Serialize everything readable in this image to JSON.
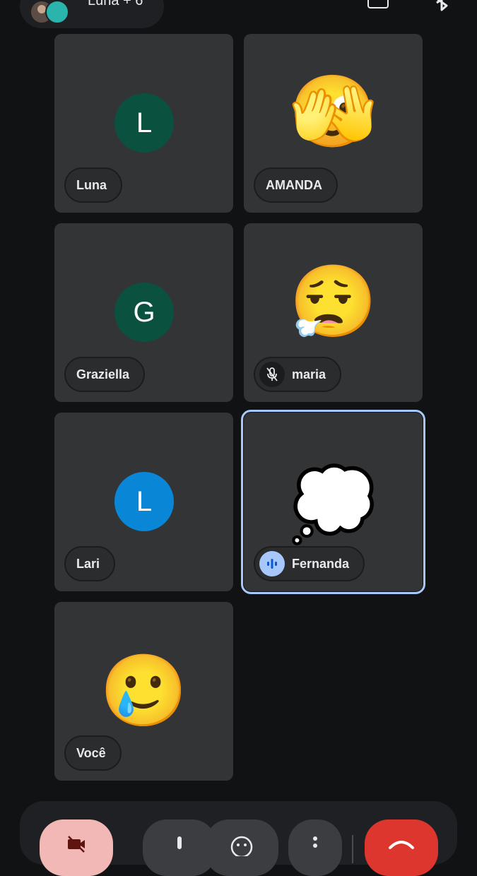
{
  "header": {
    "call_title": "Luna + 6",
    "icons": [
      "participant-avatars",
      "switch-camera-icon",
      "bluetooth-icon"
    ]
  },
  "participants": [
    {
      "name": "Luna",
      "initial": "L",
      "avatar_color": "#0b5140"
    },
    {
      "name": "AMANDA",
      "emoji": "🫣"
    },
    {
      "name": "Graziella",
      "initial": "G",
      "avatar_color": "#0b5140"
    },
    {
      "name": "maria",
      "emoji": "😮‍💨",
      "muted": true
    },
    {
      "name": "Lari",
      "initial": "L",
      "avatar_color": "#0a86d6"
    },
    {
      "name": "Fernanda",
      "emoji": "💭",
      "speaking": true
    },
    {
      "name": "Você",
      "emoji": "🥲"
    }
  ],
  "controls": {
    "icons": [
      "camera-off-icon",
      "mic-icon",
      "emoji-reaction-icon",
      "more-options-icon",
      "end-call-icon"
    ]
  },
  "colors": {
    "background": "#111213",
    "tile": "#333436",
    "active_outline": "#a8c7fa",
    "end_call": "#dc362e",
    "camera_off": "#f2b8b5"
  }
}
